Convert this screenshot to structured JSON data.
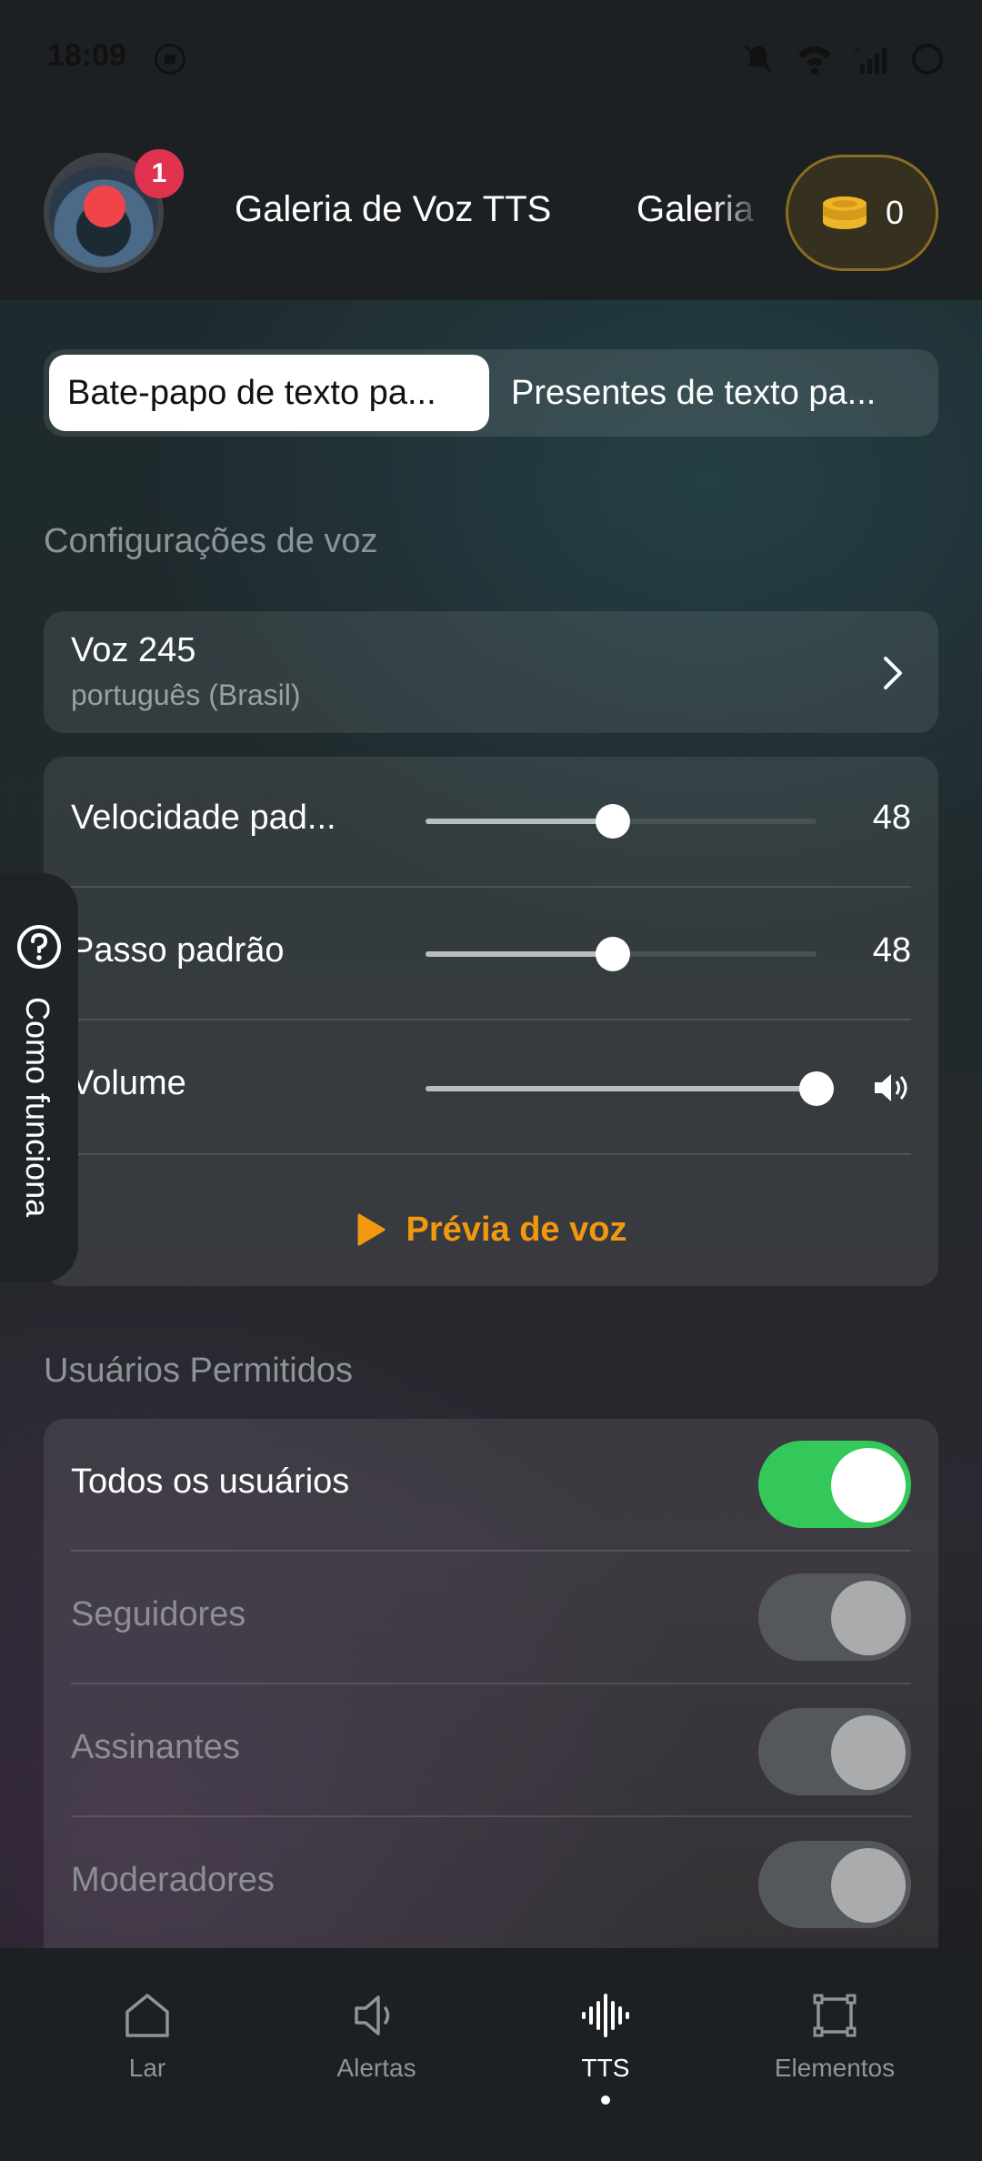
{
  "status_bar": {
    "time": "18:09"
  },
  "header": {
    "notification_count": "1",
    "tabs": [
      "Galeria de Voz TTS",
      "Galeria"
    ],
    "coins": "0"
  },
  "segmented": {
    "active": "Bate-papo de texto pa...",
    "inactive": "Presentes de texto pa..."
  },
  "voice_settings": {
    "section_title": "Configurações de voz",
    "voice_name": "Voz 245",
    "voice_language": "português (Brasil)",
    "rows": [
      {
        "label": "Velocidade pad...",
        "value": "48",
        "level": 0.48
      },
      {
        "label": "Passo padrão",
        "value": "48",
        "level": 0.48
      },
      {
        "label": "Volume",
        "value": "",
        "level": 1.0
      }
    ],
    "preview_label": "Prévia de voz"
  },
  "allowed_users": {
    "section_title": "Usuários Permitidos",
    "items": [
      {
        "label": "Todos os usuários",
        "on": true
      },
      {
        "label": "Seguidores",
        "on": false
      },
      {
        "label": "Assinantes",
        "on": false
      },
      {
        "label": "Moderadores",
        "on": false
      }
    ]
  },
  "side_tab": {
    "label": "Como funciona"
  },
  "bottom_nav": {
    "items": [
      {
        "label": "Lar",
        "icon": "home-icon"
      },
      {
        "label": "Alertas",
        "icon": "speaker-icon"
      },
      {
        "label": "TTS",
        "icon": "waveform-icon",
        "active": true
      },
      {
        "label": "Elementos",
        "icon": "elements-icon"
      }
    ]
  },
  "colors": {
    "accent_orange": "#f2980f",
    "toggle_on": "#34c759",
    "badge_red": "#e0314f",
    "coin_gold": "#f0b429"
  }
}
